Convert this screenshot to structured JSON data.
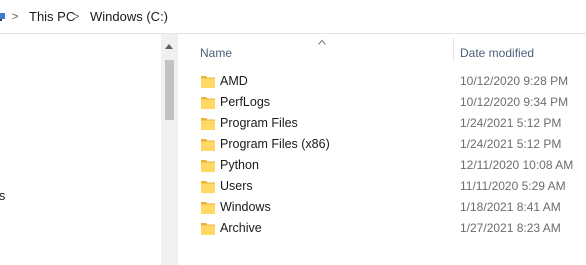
{
  "breadcrumb": {
    "items": [
      "This PC",
      "Windows (C:)"
    ],
    "separator": ">"
  },
  "nav_pane": {
    "partial_item": "ls"
  },
  "columns": {
    "name": "Name",
    "date_modified": "Date modified",
    "sort": "ascending"
  },
  "files": [
    {
      "name": "AMD",
      "date": "10/12/2020 9:28 PM",
      "icon": "folder-icon"
    },
    {
      "name": "PerfLogs",
      "date": "10/12/2020 9:34 PM",
      "icon": "folder-icon"
    },
    {
      "name": "Program Files",
      "date": "1/24/2021 5:12 PM",
      "icon": "folder-icon"
    },
    {
      "name": "Program Files (x86)",
      "date": "1/24/2021 5:12 PM",
      "icon": "folder-icon"
    },
    {
      "name": "Python",
      "date": "12/11/2020 10:08 AM",
      "icon": "folder-icon"
    },
    {
      "name": "Users",
      "date": "11/11/2020 5:29 AM",
      "icon": "folder-icon"
    },
    {
      "name": "Windows",
      "date": "1/18/2021 8:41 AM",
      "icon": "folder-icon"
    },
    {
      "name": "Archive",
      "date": "1/27/2021 8:23 AM",
      "icon": "folder-icon"
    }
  ],
  "colors": {
    "folder": "#ffd866",
    "folder_dark": "#e8b53a",
    "header_text": "#4c607a",
    "date_text": "#6d6d6d"
  }
}
